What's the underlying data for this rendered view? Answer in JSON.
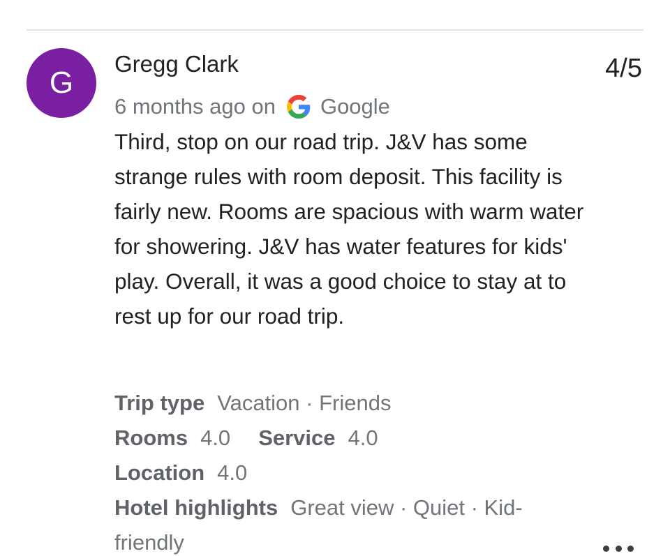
{
  "reviewer": {
    "initial": "G",
    "name": "Gregg Clark",
    "avatar_color": "#7b1fa2"
  },
  "rating": "4/5",
  "meta": {
    "time_ago": "6 months ago on",
    "source_icon": "google-g-icon",
    "source": "Google"
  },
  "review_text": "Third, stop on our road trip. J&V has some strange rules with room deposit. This facility is fairly new. Rooms are spacious with warm water for showering. J&V has water features for kids' play. Overall, it was a good choice to stay at to rest up for our road trip.",
  "details": {
    "trip_type_label": "Trip type",
    "trip_type_value": "Vacation · Friends",
    "rooms_label": "Rooms",
    "rooms_value": "4.0",
    "service_label": "Service",
    "service_value": "4.0",
    "location_label": "Location",
    "location_value": "4.0",
    "highlights_label": "Hotel highlights",
    "highlights_value": "Great view · Quiet · Kid-friendly"
  },
  "more_icon": "more-horizontal-icon",
  "colors": {
    "text_primary": "#202124",
    "text_secondary": "#70757a",
    "divider": "#e3e3e3"
  }
}
